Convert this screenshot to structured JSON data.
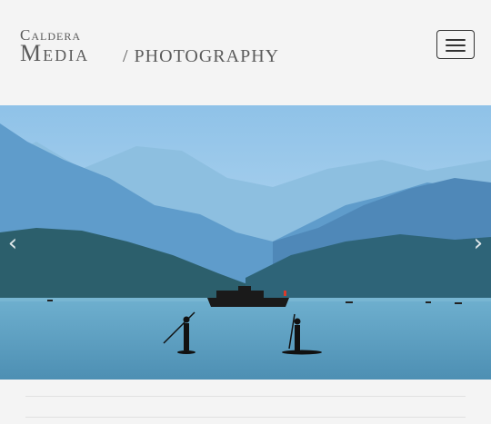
{
  "brand": {
    "line1": "Caldera",
    "line2": "Media",
    "subtitle": "/ PHOTOGRAPHY"
  },
  "nav": {
    "toggle_icon": "hamburger-icon"
  },
  "carousel": {
    "prev_glyph": "‹",
    "next_glyph": "›",
    "prev_icon": "chevron-left-icon",
    "next_icon": "chevron-right-icon",
    "slide_description_colors": {
      "sky": "#a9d2ee",
      "far_mountains": "#7fb3d6",
      "mid_mountains": "#5b95bf",
      "near_hills": "#2f5f6e",
      "water": "#5b9dbd"
    }
  }
}
